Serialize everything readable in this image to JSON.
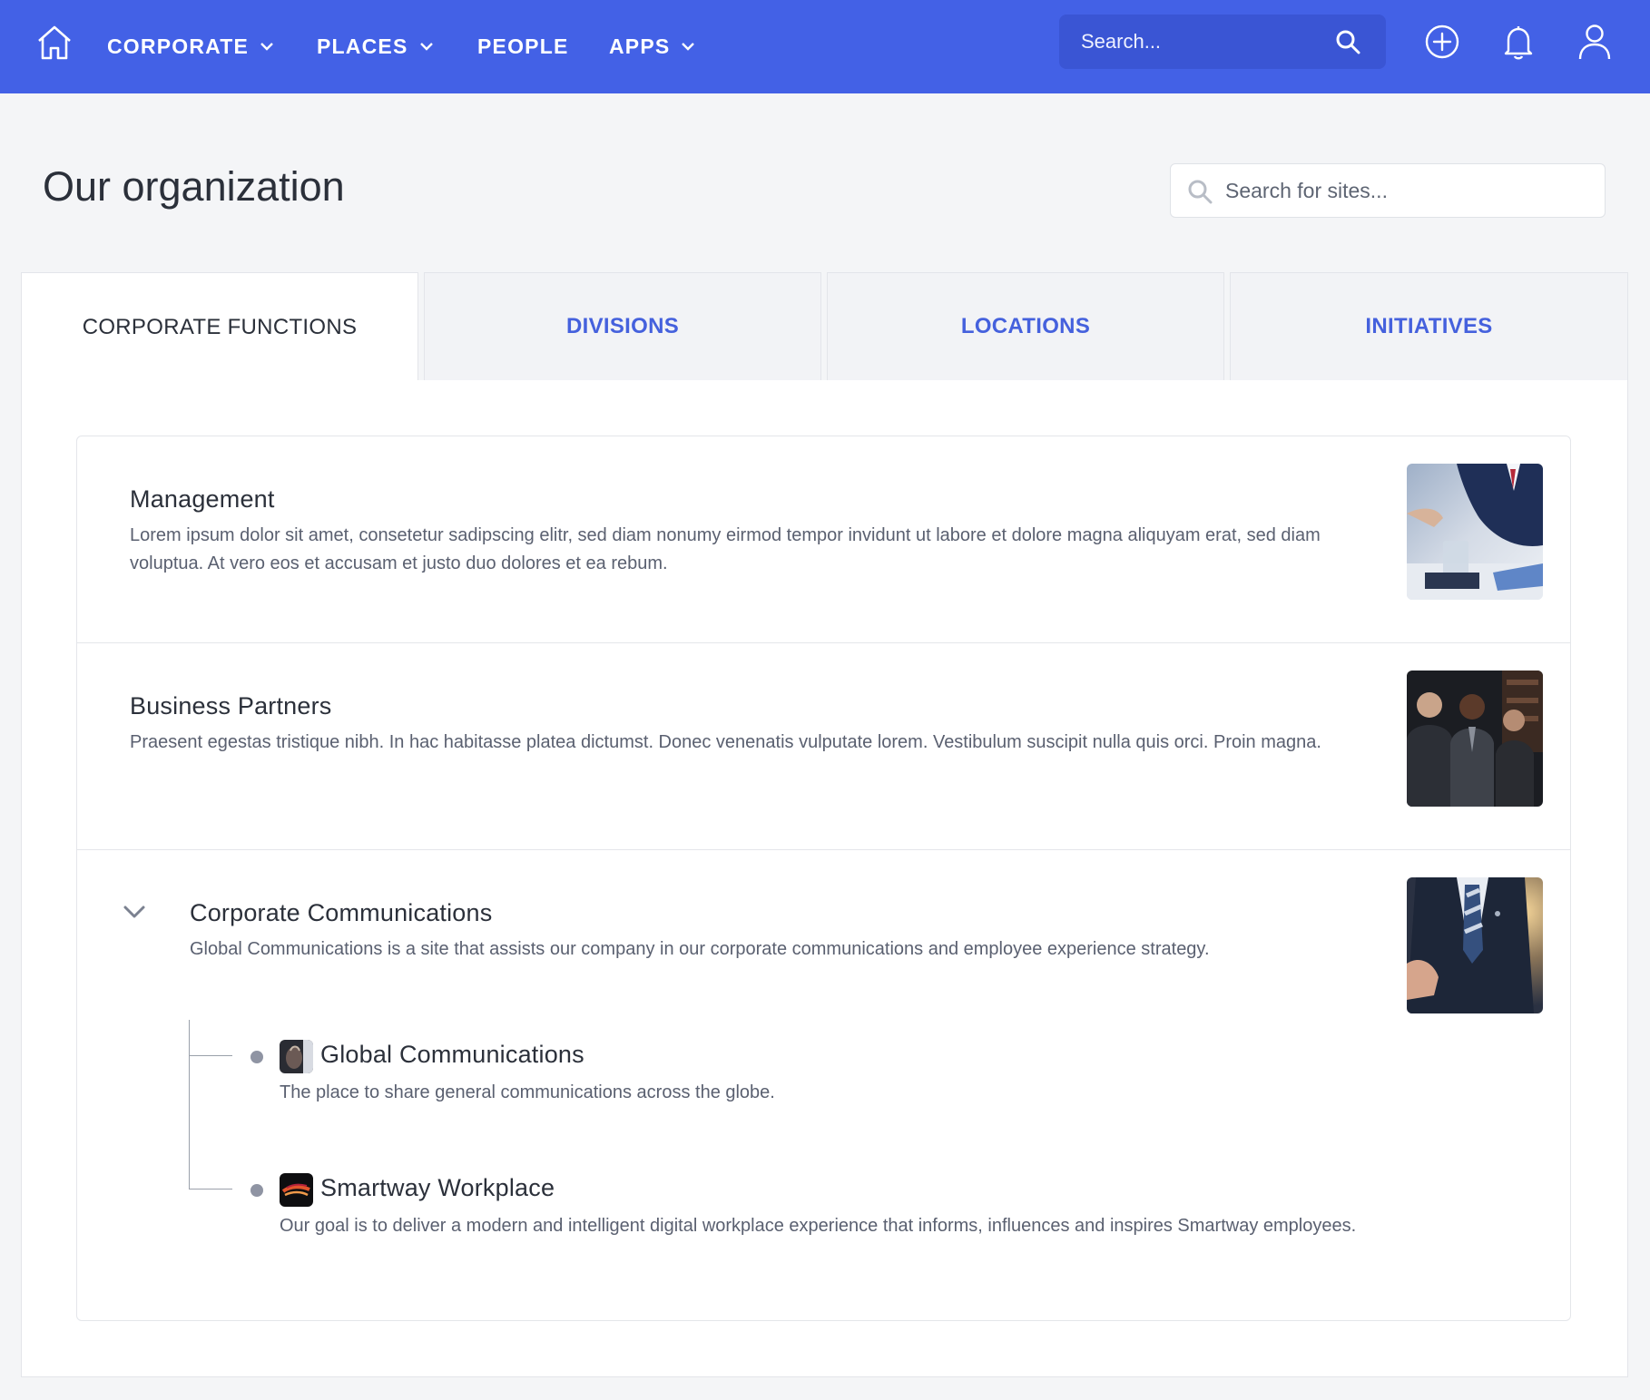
{
  "nav": {
    "items": [
      {
        "label": "CORPORATE",
        "has_dropdown": true
      },
      {
        "label": "PLACES",
        "has_dropdown": true
      },
      {
        "label": "PEOPLE",
        "has_dropdown": false
      },
      {
        "label": "APPS",
        "has_dropdown": true
      }
    ],
    "search_placeholder": "Search...",
    "icons": [
      "home-icon",
      "search-icon",
      "plus-circle-icon",
      "bell-icon",
      "user-icon"
    ]
  },
  "page": {
    "title": "Our organization",
    "site_search_placeholder": "Search for sites..."
  },
  "tabs": [
    {
      "label": "CORPORATE FUNCTIONS",
      "active": true
    },
    {
      "label": "DIVISIONS",
      "active": false
    },
    {
      "label": "LOCATIONS",
      "active": false
    },
    {
      "label": "INITIATIVES",
      "active": false
    }
  ],
  "sites": [
    {
      "title": "Management",
      "description": "Lorem ipsum dolor sit amet, consetetur sadipscing elitr, sed diam nonumy eirmod tempor invidunt ut labore et dolore magna aliquyam erat, sed diam voluptua. At vero eos et accusam et justo duo dolores et ea rebum.",
      "image": "meeting-photo"
    },
    {
      "title": "Business Partners",
      "description": "Praesent egestas tristique nibh. In hac habitasse platea dictumst. Donec venenatis vulputate lorem. Vestibulum suscipit nulla quis orci. Proin magna.",
      "image": "businessmen-photo"
    },
    {
      "title": "Corporate Communications",
      "description": "Global Communications is a site that assists our company in our corporate communications and employee experience strategy.",
      "image": "suit-pointing-photo",
      "expanded": true,
      "children": [
        {
          "title": "Global Communications",
          "description": "The place to share general communications across the globe."
        },
        {
          "title": "Smartway Workplace",
          "description": "Our goal is to deliver a modern and intelligent digital workplace experience that informs, influences and inspires Smartway employees."
        }
      ]
    }
  ],
  "colors": {
    "nav_bg": "#4361e6",
    "accent": "#4561dd",
    "page_bg": "#f4f5f7"
  }
}
